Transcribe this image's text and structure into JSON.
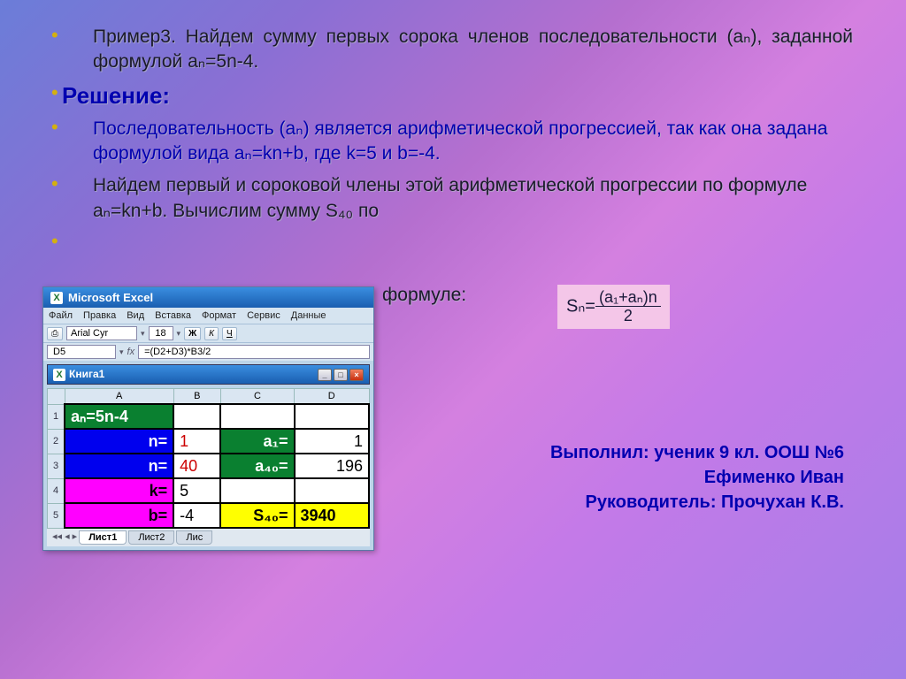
{
  "slide": {
    "p1": "Пример3. Найдем сумму первых сорока членов последовательности (aₙ), заданной формулой aₙ=5n-4.",
    "h1": "Решение:",
    "p2": "Последовательность (aₙ) является арифметической прогрессией, так как она задана формулой вида aₙ=kn+b, где k=5 и b=-4.",
    "p3": "Найдем первый и сороковой члены этой арифметической прогрессии по формуле aₙ=kn+b. Вычислим сумму S₄₀ по",
    "formula_label": "формуле:",
    "formula_lhs": "Sₙ=",
    "formula_num": "(a₁+aₙ)n",
    "formula_den": "2"
  },
  "credits": {
    "l1": "Выполнил: ученик 9 кл. ООШ №6",
    "l2": "Ефименко Иван",
    "l3": "Руководитель: Прочухан К.В."
  },
  "excel": {
    "title": "Microsoft Excel",
    "menu": [
      "Файл",
      "Правка",
      "Вид",
      "Вставка",
      "Формат",
      "Сервис",
      "Данные"
    ],
    "font": "Arial Cyr",
    "size": "18",
    "bold": "Ж",
    "italic": "К",
    "underline": "Ч",
    "namebox": "D5",
    "fx_label": "fx",
    "formula": "=(D2+D3)*B3/2",
    "workbook": "Книга1",
    "cols": [
      "A",
      "B",
      "C",
      "D"
    ],
    "rows": [
      {
        "n": "1",
        "a": "aₙ=5n-4",
        "a_class": "hdr-green",
        "b": "",
        "c": "",
        "d": ""
      },
      {
        "n": "2",
        "a": "n=",
        "a_class": "lbl-blue",
        "b": "1",
        "b_class": "val-red",
        "c": "a₁=",
        "c_class": "lbl-green",
        "d": "1"
      },
      {
        "n": "3",
        "a": "n=",
        "a_class": "lbl-blue",
        "b": "40",
        "b_class": "val-red",
        "c": "a₄₀=",
        "c_class": "lbl-green",
        "d": "196"
      },
      {
        "n": "4",
        "a": "k=",
        "a_class": "lbl-mag",
        "b": "5",
        "b_class": "val-black",
        "c": "",
        "d": ""
      },
      {
        "n": "5",
        "a": "b=",
        "a_class": "lbl-mag",
        "b": "-4",
        "b_class": "val-black",
        "c": "S₄₀=",
        "c_class": "lbl-yellow",
        "d": "3940",
        "d_class": "val-yellow"
      }
    ],
    "tabs": [
      "Лист1",
      "Лист2",
      "Лис"
    ]
  }
}
